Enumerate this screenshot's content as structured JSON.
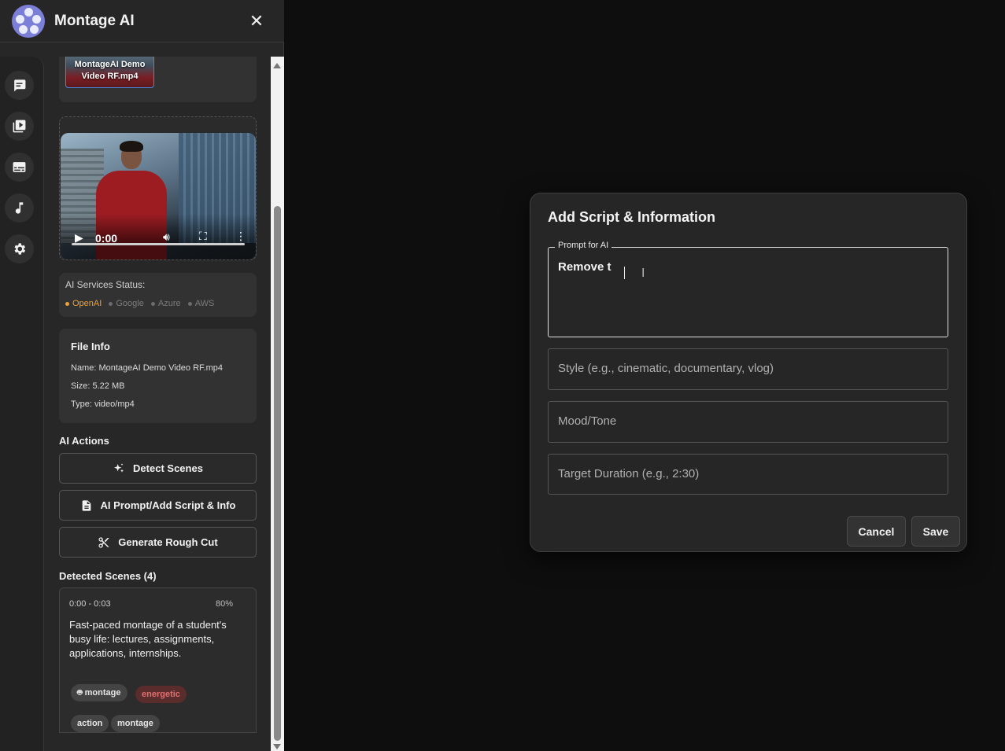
{
  "app": {
    "title": "Montage AI",
    "close_icon": "close-icon"
  },
  "rail": {
    "items": [
      {
        "icon": "chat-icon",
        "label": "Chat"
      },
      {
        "icon": "video-library-icon",
        "label": "Media"
      },
      {
        "icon": "subtitles-icon",
        "label": "Subtitles"
      },
      {
        "icon": "music-note-icon",
        "label": "Audio"
      },
      {
        "icon": "gear-icon",
        "label": "Settings"
      }
    ]
  },
  "media": {
    "thumbnail_label": "MontageAI Demo Video RF.mp4",
    "player": {
      "time": "0:00",
      "progress": 0.0
    }
  },
  "services": {
    "title": "AI Services Status:",
    "items": [
      {
        "name": "OpenAI",
        "active": true
      },
      {
        "name": "Google",
        "active": false
      },
      {
        "name": "Azure",
        "active": false
      },
      {
        "name": "AWS",
        "active": false
      }
    ],
    "active_color": "#f0a030"
  },
  "file_info": {
    "title": "File Info",
    "name": "Name: MontageAI Demo Video RF.mp4",
    "size": "Size: 5.22 MB",
    "type": "Type: video/mp4"
  },
  "ai_actions": {
    "title": "AI Actions",
    "buttons": [
      {
        "label": "Detect Scenes",
        "icon": "sparkle-icon"
      },
      {
        "label": "AI Prompt/Add Script & Info",
        "icon": "document-icon"
      },
      {
        "label": "Generate Rough Cut",
        "icon": "scissors-icon"
      }
    ]
  },
  "scenes": {
    "title": "Detected Scenes (4)",
    "items": [
      {
        "time": "0:00 - 0:03",
        "confidence": "80%",
        "description": "Fast-paced montage of a student's busy life: lectures, assignments, applications, internships.",
        "tags": [
          "montage",
          "energetic",
          "action",
          "montage"
        ]
      }
    ]
  },
  "modal": {
    "title": "Add Script & Information",
    "prompt": {
      "legend": "Prompt for AI",
      "value": "Remove t"
    },
    "style": {
      "placeholder": "Style (e.g., cinematic, documentary, vlog)"
    },
    "mood": {
      "placeholder": "Mood/Tone"
    },
    "duration": {
      "placeholder": "Target Duration (e.g., 2:30)"
    },
    "cancel_label": "Cancel",
    "save_label": "Save"
  }
}
